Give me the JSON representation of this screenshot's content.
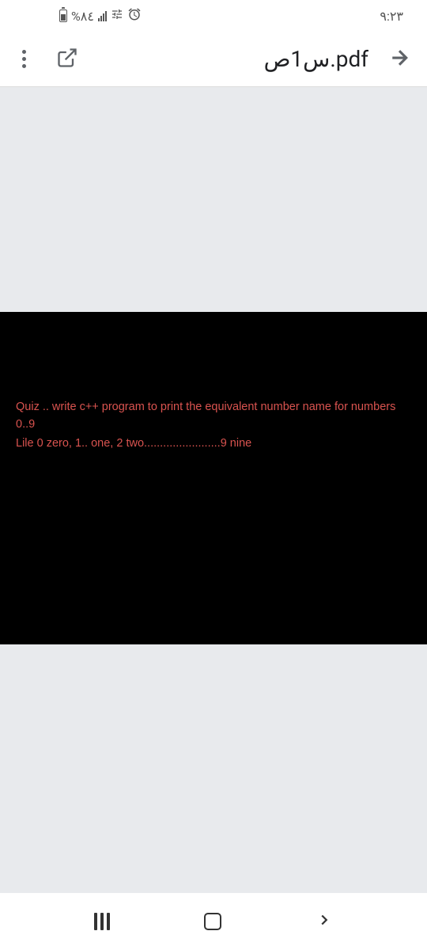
{
  "status": {
    "battery_text": "%٨٤",
    "time": "٩:٢٣"
  },
  "appbar": {
    "title": "س1ص.pdf"
  },
  "slide": {
    "line1": "Quiz ..  write c++ program to print the equivalent number name for numbers 0..9",
    "line2": "Lile   0    zero, 1.. one, 2    two........................9  nine"
  }
}
